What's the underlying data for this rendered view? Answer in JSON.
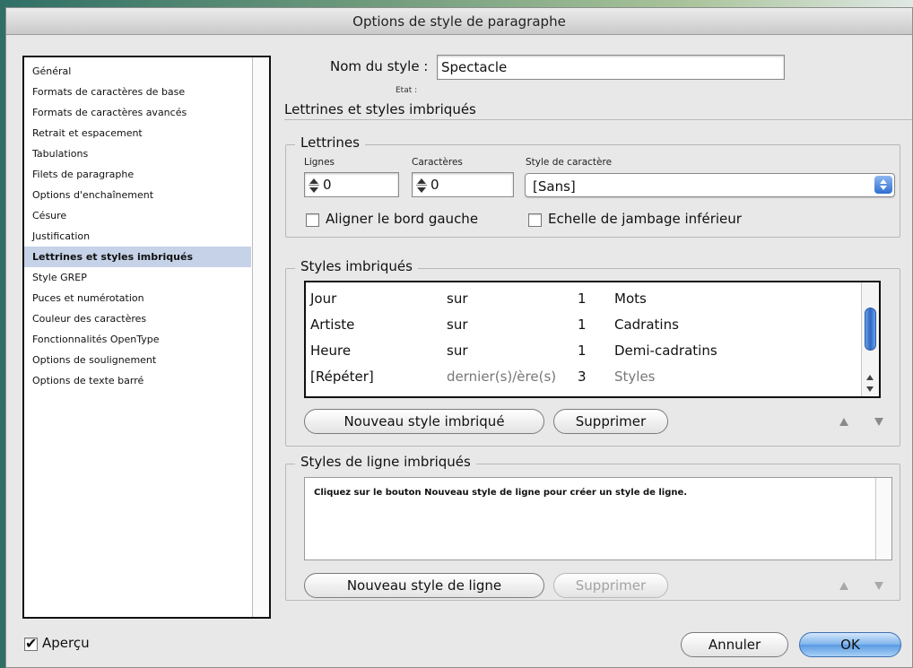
{
  "dialog": {
    "title": "Options de style de paragraphe"
  },
  "sidebar": {
    "items": [
      {
        "label": "Général"
      },
      {
        "label": "Formats de caractères de base"
      },
      {
        "label": "Formats de caractères avancés"
      },
      {
        "label": "Retrait et espacement"
      },
      {
        "label": "Tabulations"
      },
      {
        "label": "Filets de paragraphe"
      },
      {
        "label": "Options d'enchaînement"
      },
      {
        "label": "Césure"
      },
      {
        "label": "Justification"
      },
      {
        "label": "Lettrines et styles imbriqués",
        "selected": true
      },
      {
        "label": "Style GREP"
      },
      {
        "label": "Puces et numérotation"
      },
      {
        "label": "Couleur des caractères"
      },
      {
        "label": "Fonctionnalités OpenType"
      },
      {
        "label": "Options de soulignement"
      },
      {
        "label": "Options de texte barré"
      }
    ]
  },
  "style": {
    "name_label": "Nom du style :",
    "name_value": "Spectacle",
    "etat_label": "Etat :",
    "section_title": "Lettrines et styles imbriqués"
  },
  "lettrines": {
    "title": "Lettrines",
    "lignes_label": "Lignes",
    "lignes_value": "0",
    "caracteres_label": "Caractères",
    "caracteres_value": "0",
    "style_label": "Style de caractère",
    "style_value": "[Sans]",
    "align_label": "Aligner le bord gauche",
    "align_checked": false,
    "echelle_label": "Echelle de jambage inférieur",
    "echelle_checked": false
  },
  "nested": {
    "title": "Styles imbriqués",
    "rows": [
      {
        "style": "Jour",
        "through": "sur",
        "count": "1",
        "unit": "Mots"
      },
      {
        "style": "Artiste",
        "through": "sur",
        "count": "1",
        "unit": "Cadratins"
      },
      {
        "style": "Heure",
        "through": "sur",
        "count": "1",
        "unit": "Demi-cadratins"
      },
      {
        "style": "[Répéter]",
        "through": "dernier(s)/ère(s)",
        "count": "3",
        "unit": "Styles"
      }
    ],
    "new_button": "Nouveau style imbriqué",
    "delete_button": "Supprimer"
  },
  "line_styles": {
    "title": "Styles de ligne imbriqués",
    "hint": "Cliquez sur le bouton Nouveau style de ligne pour créer un style de ligne.",
    "new_button": "Nouveau style de ligne",
    "delete_button": "Supprimer"
  },
  "footer": {
    "preview_label": "Aperçu",
    "preview_checked": true,
    "cancel_button": "Annuler",
    "ok_button": "OK"
  },
  "colors": {
    "dialog_bg": "#e8e8e8",
    "selection": "#c5d2e8",
    "accent_blue": "#2e6ed2"
  }
}
